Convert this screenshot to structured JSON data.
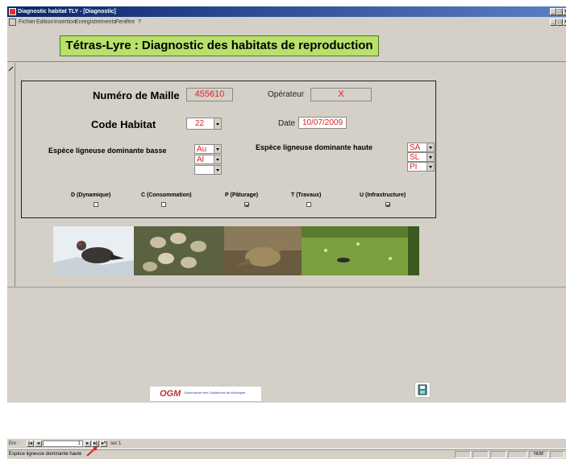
{
  "window": {
    "title": "Diagnostic habitat TLY - [Diagnostic]",
    "min": "_",
    "restore": "□",
    "close": "×"
  },
  "menu": [
    "Fichier",
    "Edition",
    "Insertion",
    "Enregistrements",
    "Fenêtre",
    "?"
  ],
  "banner": {
    "title": "Tétras-Lyre : Diagnostic des habitats de reproduction",
    "color": "#b8e06a"
  },
  "form": {
    "maille_label": "Numéro de Maille",
    "maille_value": "455610",
    "operateur_label": "Opérateur",
    "operateur_value": "X",
    "habitat_label": "Code Habitat",
    "habitat_value": "22",
    "date_label": "Date",
    "date_value": "10/07/2009",
    "basse_label": "Espèce ligneuse dominante basse",
    "basse_values": [
      "Au",
      "Al",
      ""
    ],
    "haute_label": "Espèce ligneuse dominante haute",
    "haute_values": [
      "SA",
      "SL",
      "PI"
    ],
    "checkboxes": [
      {
        "label": "D (Dynamique)",
        "checked": false
      },
      {
        "label": "C (Consommation)",
        "checked": false
      },
      {
        "label": "P (Pâturage)",
        "checked": true
      },
      {
        "label": "T (Travaux)",
        "checked": false
      },
      {
        "label": "U (Infrastructure)",
        "checked": true
      }
    ]
  },
  "footer": {
    "logo_abbr": "OGM",
    "logo_text": "Observatoire des Galliformes de Montagne"
  },
  "navigation": {
    "label": "Enr :",
    "record": "1",
    "of_label": "sur 1"
  },
  "status": {
    "text": "Espèce ligneuse dominante haute",
    "num": "NUM"
  },
  "colors": {
    "value_text": "#e02020",
    "titlebar": "#0a246a"
  },
  "icons": [
    "app-icon",
    "form-icon",
    "save-icon",
    "first-record-icon",
    "prev-record-icon",
    "next-record-icon",
    "last-record-icon",
    "new-record-icon",
    "mouse-pointer-icon"
  ]
}
